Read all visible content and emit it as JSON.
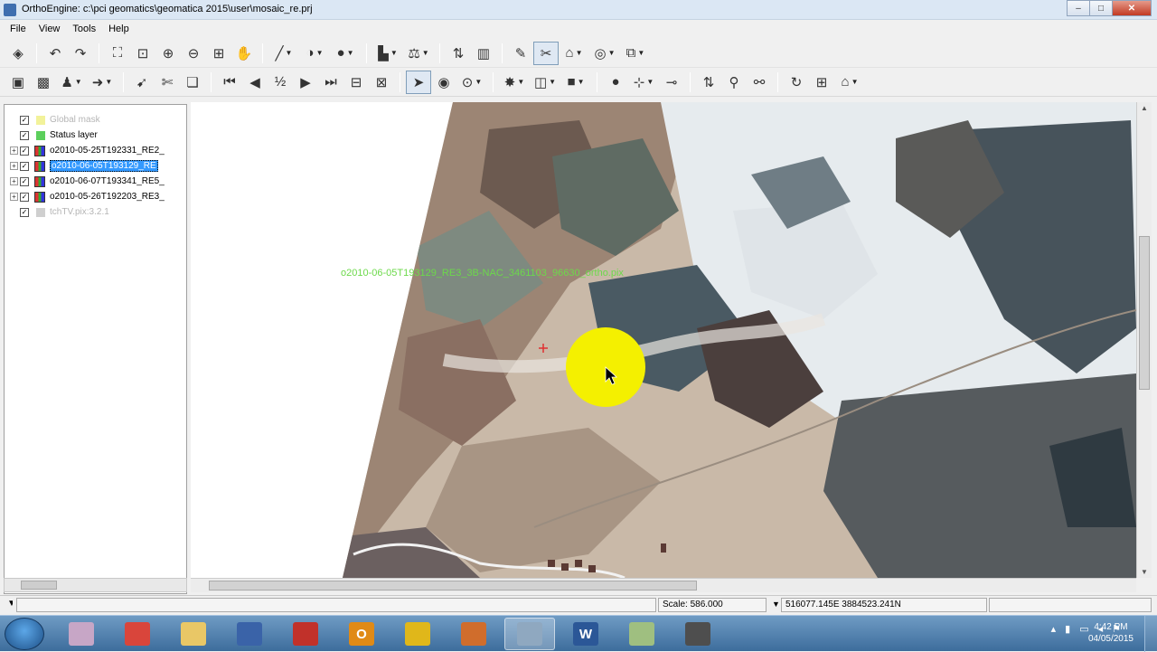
{
  "window": {
    "title": "OrthoEngine: c:\\pci geomatics\\geomatica 2015\\user\\mosaic_re.prj",
    "controls": {
      "minimize": "–",
      "maximize": "□",
      "close": "✕"
    }
  },
  "menu": [
    "File",
    "View",
    "Tools",
    "Help"
  ],
  "toolbar1": [
    {
      "name": "layers-icon",
      "glyph": "◈"
    },
    {
      "name": "undo-icon",
      "glyph": "↶"
    },
    {
      "name": "redo-icon",
      "glyph": "↷"
    },
    {
      "name": "zoom-extent-icon",
      "glyph": "⛶"
    },
    {
      "name": "zoom-layer-icon",
      "glyph": "⊡"
    },
    {
      "name": "zoom-in-icon",
      "glyph": "⊕"
    },
    {
      "name": "zoom-out-icon",
      "glyph": "⊖"
    },
    {
      "name": "zoom-box-icon",
      "glyph": "⊞"
    },
    {
      "name": "pan-hand-icon",
      "glyph": "✋"
    },
    {
      "name": "draw-line-icon",
      "glyph": "╱"
    },
    {
      "name": "enhance-icon",
      "glyph": "◑"
    },
    {
      "name": "light-icon",
      "glyph": "●"
    },
    {
      "name": "histogram-icon",
      "glyph": "▙"
    },
    {
      "name": "balance-icon",
      "glyph": "⚖"
    },
    {
      "name": "xy-icon",
      "glyph": "⇅"
    },
    {
      "name": "bands-icon",
      "glyph": "▥"
    },
    {
      "name": "edit-icon",
      "glyph": "✎"
    },
    {
      "name": "cutline-icon",
      "glyph": "✂"
    },
    {
      "name": "polygon-icon",
      "glyph": "⌂"
    },
    {
      "name": "render-icon",
      "glyph": "◎"
    },
    {
      "name": "network-icon",
      "glyph": "⧉"
    }
  ],
  "toolbar2": [
    {
      "name": "add-image-icon",
      "glyph": "▣"
    },
    {
      "name": "mosaic-icon",
      "glyph": "▩"
    },
    {
      "name": "stamp-icon",
      "glyph": "♟"
    },
    {
      "name": "export-icon",
      "glyph": "➜"
    },
    {
      "name": "select-mosaic-icon",
      "glyph": "➹"
    },
    {
      "name": "cut-icon",
      "glyph": "✄"
    },
    {
      "name": "copy-icon",
      "glyph": "❏"
    },
    {
      "name": "first-icon",
      "glyph": "⏮"
    },
    {
      "name": "prev-icon",
      "glyph": "◀"
    },
    {
      "name": "half-icon",
      "glyph": "½"
    },
    {
      "name": "next-icon",
      "glyph": "▶"
    },
    {
      "name": "last-icon",
      "glyph": "⏭"
    },
    {
      "name": "split-icon",
      "glyph": "⊟"
    },
    {
      "name": "merge-icon",
      "glyph": "⊠"
    },
    {
      "name": "pointer-icon",
      "glyph": "➤"
    },
    {
      "name": "target-icon",
      "glyph": "◉"
    },
    {
      "name": "zoom-select-icon",
      "glyph": "⊙"
    },
    {
      "name": "bulb-icon",
      "glyph": "✸"
    },
    {
      "name": "frame-icon",
      "glyph": "◫"
    },
    {
      "name": "fill-icon",
      "glyph": "■"
    },
    {
      "name": "point-icon",
      "glyph": "●"
    },
    {
      "name": "grid-select-icon",
      "glyph": "⊹"
    },
    {
      "name": "link-icon",
      "glyph": "⊸"
    },
    {
      "name": "arrows-icon",
      "glyph": "⇅"
    },
    {
      "name": "pins-icon",
      "glyph": "⚲"
    },
    {
      "name": "connect-icon",
      "glyph": "⚯"
    },
    {
      "name": "refresh-icon",
      "glyph": "↻"
    },
    {
      "name": "tiles-icon",
      "glyph": "⊞"
    },
    {
      "name": "tower-icon",
      "glyph": "⌂"
    }
  ],
  "layers": [
    {
      "label": "Global mask",
      "dim": true,
      "expander": false,
      "checked": true,
      "swatch": "#f2f29a"
    },
    {
      "label": "Status layer",
      "dim": false,
      "expander": false,
      "checked": true,
      "swatch": "#5ccf5c"
    },
    {
      "label": "o2010-05-25T192331_RE2_",
      "dim": false,
      "expander": true,
      "checked": true,
      "rgb": true
    },
    {
      "label": "o2010-06-05T193129_RE",
      "dim": false,
      "expander": true,
      "checked": true,
      "rgb": true,
      "selected": true
    },
    {
      "label": "o2010-06-07T193341_RE5_",
      "dim": false,
      "expander": true,
      "checked": true,
      "rgb": true
    },
    {
      "label": "o2010-05-26T192203_RE3_",
      "dim": false,
      "expander": true,
      "checked": true,
      "rgb": true
    },
    {
      "label": "tchTV.pix:3.2.1",
      "dim": true,
      "expander": false,
      "checked": true,
      "swatch": "#cfcfcf"
    }
  ],
  "map": {
    "image_label": "o2010-06-05T193129_RE3_3B-NAC_3461103_96630_ortho.pix",
    "label_color": "#6cd94a",
    "cursor_highlight_color": "#f4f000",
    "crosshair_color": "#e03030"
  },
  "status": {
    "scale": "Scale: 586.000",
    "coordinates": "516077.145E 3884523.241N"
  },
  "taskbar": {
    "apps": [
      {
        "name": "paint-app-icon",
        "text": "",
        "color": "#c7a6c6"
      },
      {
        "name": "chrome-app-icon",
        "text": "",
        "color": "#d9453b"
      },
      {
        "name": "explorer-app-icon",
        "text": "",
        "color": "#e9c766"
      },
      {
        "name": "focus-app-icon",
        "text": "",
        "color": "#3a63a8"
      },
      {
        "name": "nodrop-app-icon",
        "text": "",
        "color": "#c1312a"
      },
      {
        "name": "outlook-app-icon",
        "text": "O",
        "color": "#e08a16"
      },
      {
        "name": "lync-app-icon",
        "text": "",
        "color": "#e0b71a"
      },
      {
        "name": "matlab-app-icon",
        "text": "",
        "color": "#d06d2c"
      },
      {
        "name": "orthoengine-app-icon",
        "text": "",
        "color": "#8fa8c0",
        "active": true
      },
      {
        "name": "word-app-icon",
        "text": "W",
        "color": "#2b5797"
      },
      {
        "name": "map-app-icon",
        "text": "",
        "color": "#9fbf80"
      },
      {
        "name": "recorder-app-icon",
        "text": "",
        "color": "#4e4e4e"
      }
    ],
    "time": "4:42 PM",
    "date": "04/05/2015"
  }
}
